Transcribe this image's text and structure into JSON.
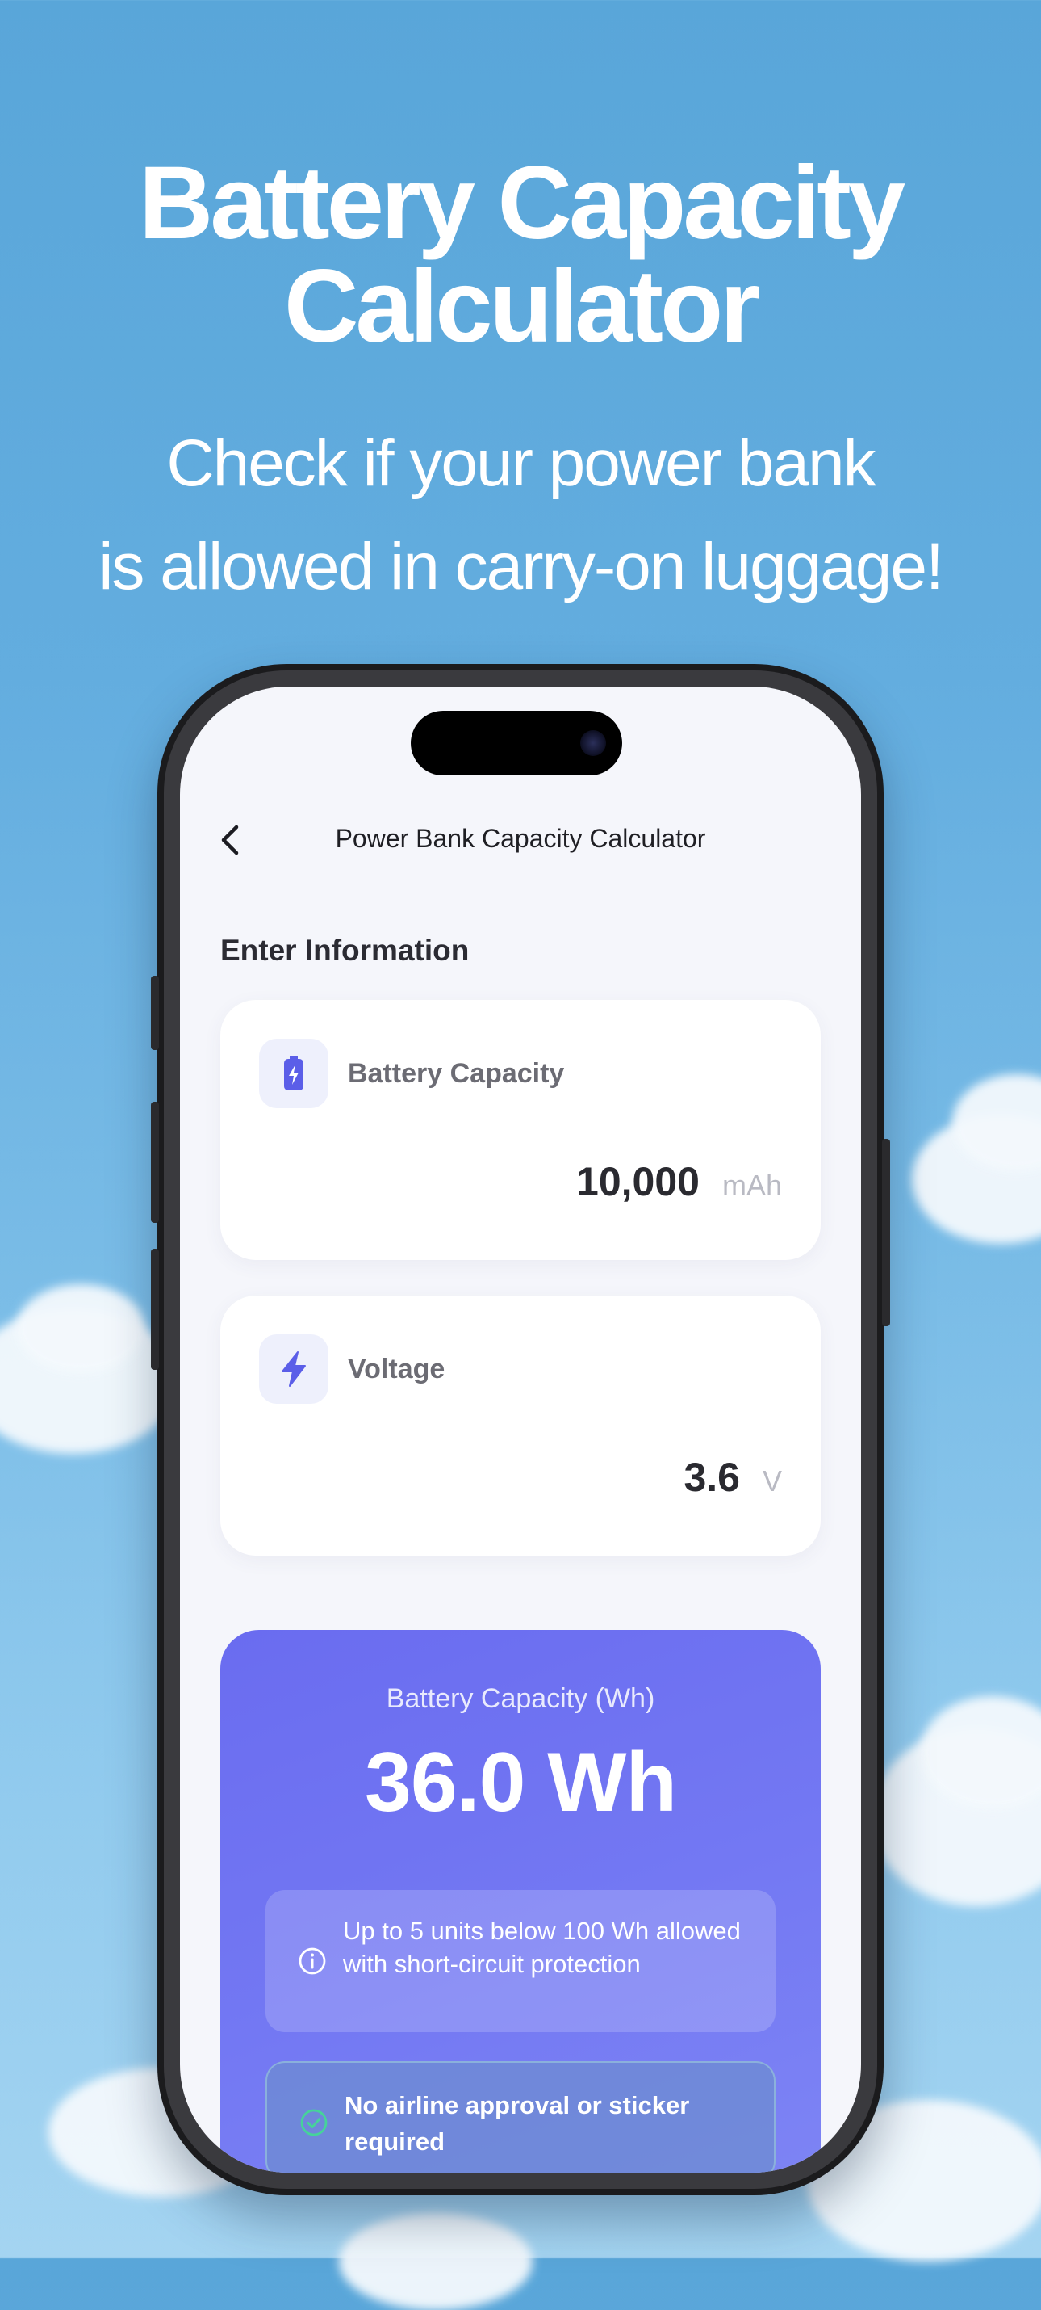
{
  "promo": {
    "title_line1": "Battery Capacity",
    "title_line2": "Calculator",
    "subtitle_line1": "Check if your power bank",
    "subtitle_line2": "is allowed in carry-on luggage!"
  },
  "app": {
    "nav": {
      "back_icon": "chevron-left-icon",
      "title": "Power Bank Capacity Calculator"
    },
    "section_label": "Enter Information",
    "inputs": [
      {
        "icon": "battery-charging-icon",
        "label": "Battery Capacity",
        "value": "10,000",
        "unit": "mAh"
      },
      {
        "icon": "lightning-bolt-icon",
        "label": "Voltage",
        "value": "3.6",
        "unit": "V"
      }
    ],
    "result": {
      "label": "Battery Capacity (Wh)",
      "value": "36.0 Wh",
      "info": {
        "icon": "info-circle-icon",
        "text": "Up to 5 units below 100 Wh allowed with short-circuit protection"
      },
      "status": {
        "icon": "check-circle-icon",
        "text": "No airline approval or sticker required"
      }
    }
  },
  "colors": {
    "accent": "#6a6cf0",
    "sky": "#63addf",
    "card_bg": "#ffffff",
    "screen_bg": "#f5f6fb"
  }
}
